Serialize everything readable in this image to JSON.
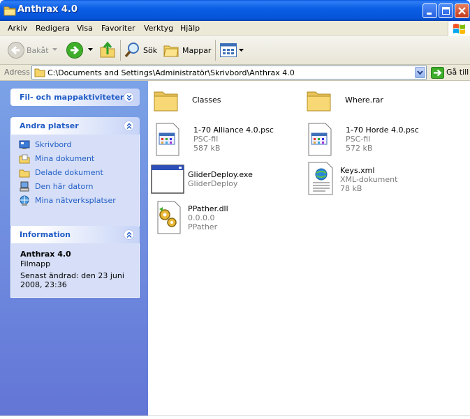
{
  "window": {
    "title": "Anthrax 4.0",
    "icon": "folder-icon",
    "controls": [
      "minimize-icon",
      "maximize-icon",
      "close-icon"
    ]
  },
  "menu": {
    "items": [
      "Arkiv",
      "Redigera",
      "Visa",
      "Favoriter",
      "Verktyg",
      "Hjälp"
    ]
  },
  "toolbar": {
    "back_label": "Bakåt",
    "search_label": "Sök",
    "folders_label": "Mappar"
  },
  "address": {
    "label": "Adress",
    "path": "C:\\Documents and Settings\\Administratör\\Skrivbord\\Anthrax 4.0",
    "go_label": "Gå till"
  },
  "taskpane": {
    "file_tasks": {
      "title": "Fil- och mappaktiviteter",
      "state": "collapsed"
    },
    "other_places": {
      "title": "Andra platser",
      "state": "expanded",
      "links": [
        {
          "label": "Skrivbord",
          "icon": "desktop-icon"
        },
        {
          "label": "Mina dokument",
          "icon": "my-documents-icon"
        },
        {
          "label": "Delade dokument",
          "icon": "shared-folder-icon"
        },
        {
          "label": "Den här datorn",
          "icon": "my-computer-icon"
        },
        {
          "label": "Mina nätverksplatser",
          "icon": "network-places-icon"
        }
      ]
    },
    "details": {
      "title": "Information",
      "state": "expanded",
      "name": "Anthrax 4.0",
      "type": "Filmapp",
      "modified": "Senast ändrad: den 23 juni 2008, 23:36"
    }
  },
  "files": [
    {
      "name": "Classes",
      "icon": "folder-icon"
    },
    {
      "name": "Where.rar",
      "icon": "folder-icon"
    },
    {
      "name": "1-70 Alliance 4.0.psc",
      "type": "PSC-fil",
      "size": "587 kB",
      "icon": "generic-file-icon"
    },
    {
      "name": "1-70 Horde 4.0.psc",
      "type": "PSC-fil",
      "size": "572 kB",
      "icon": "generic-file-icon"
    },
    {
      "name": "GliderDeploy.exe",
      "type": "GliderDeploy",
      "icon": "application-window-icon"
    },
    {
      "name": "Keys.xml",
      "type": "XML-dokument",
      "size": "78 kB",
      "icon": "xml-document-icon"
    },
    {
      "name": "PPather.dll",
      "type": "0.0.0.0",
      "size": "PPather",
      "icon": "dll-gear-icon"
    }
  ],
  "colors": {
    "titlebar": "#0a5ee5",
    "taskpane_top": "#7ba2e7",
    "taskpane_bottom": "#6375d6",
    "link": "#215dc6",
    "folder": "#f5d56a"
  }
}
